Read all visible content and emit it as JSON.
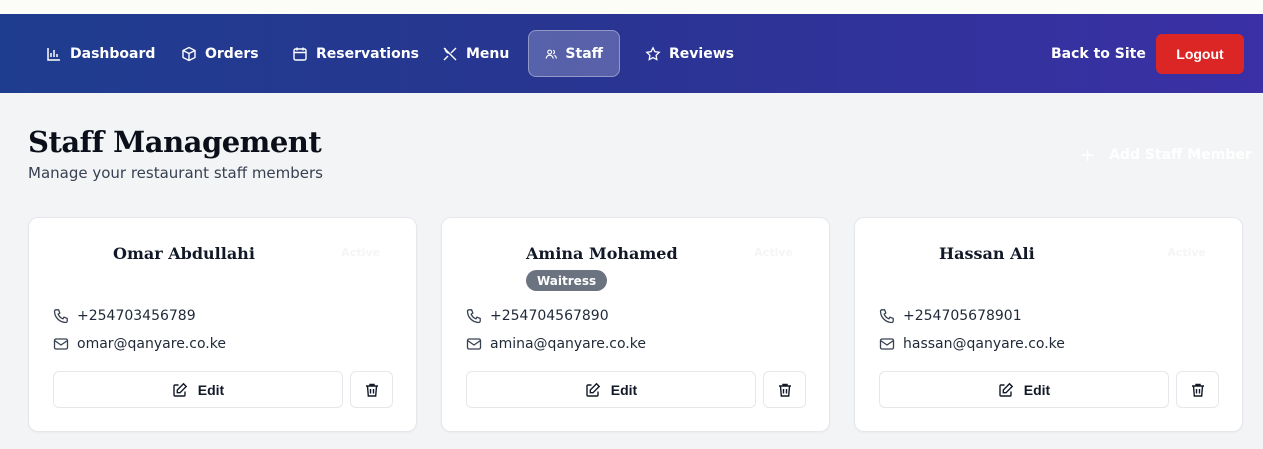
{
  "nav": {
    "items": [
      {
        "label": "Dashboard",
        "icon": "bar-chart-icon"
      },
      {
        "label": "Orders",
        "icon": "package-icon"
      },
      {
        "label": "Reservations",
        "icon": "calendar-icon"
      },
      {
        "label": "Menu",
        "icon": "utensils-icon"
      },
      {
        "label": "Staff",
        "icon": "users-icon",
        "active": true
      },
      {
        "label": "Reviews",
        "icon": "star-icon"
      }
    ],
    "back_label": "Back to Site",
    "logout_label": "Logout"
  },
  "header": {
    "title": "Staff Management",
    "subtitle": "Manage your restaurant staff members",
    "add_label": "Add Staff Member"
  },
  "staff": [
    {
      "name": "Omar Abdullahi",
      "status": "Active",
      "role": "",
      "phone": "+254703456789",
      "email": "omar@qanyare.co.ke",
      "edit_label": "Edit"
    },
    {
      "name": "Amina Mohamed",
      "status": "Active",
      "role": "Waitress",
      "phone": "+254704567890",
      "email": "amina@qanyare.co.ke",
      "edit_label": "Edit"
    },
    {
      "name": "Hassan Ali",
      "status": "Active",
      "role": "",
      "phone": "+254705678901",
      "email": "hassan@qanyare.co.ke",
      "edit_label": "Edit"
    }
  ],
  "colors": {
    "nav_start": "#1f3d8f",
    "nav_end": "#3b30a6",
    "logout": "#dc2626",
    "badge": "#6b7280"
  }
}
